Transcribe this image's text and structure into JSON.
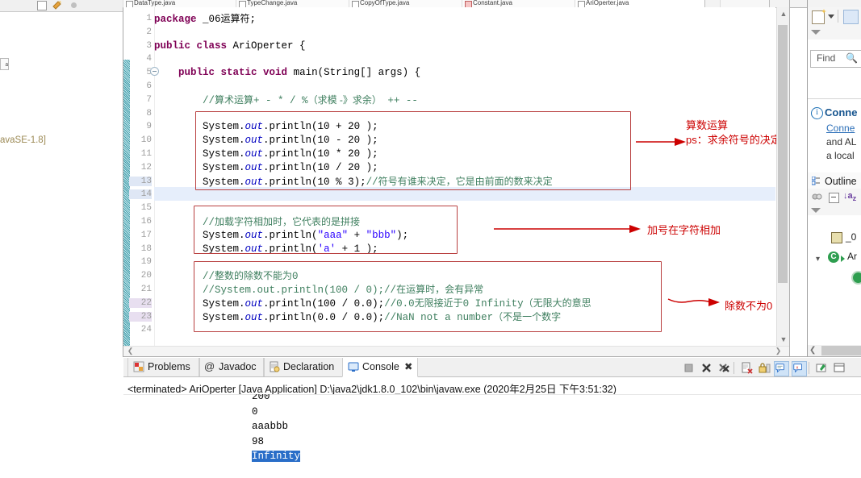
{
  "app": {
    "ide": "Eclipse",
    "perspective": "Java"
  },
  "left_panel": {
    "jre_label": "avaSE-1.8]",
    "node_glyph": "a",
    "toolbar_icons": [
      "new-file-icon",
      "view-menu-icon",
      "collapse-all-icon"
    ]
  },
  "editor": {
    "tabs": [
      {
        "label": "DataType.java",
        "active": false,
        "dirty": false
      },
      {
        "label": "TypeChange.java",
        "active": false,
        "dirty": false
      },
      {
        "label": "CopyOfType.java",
        "active": false,
        "dirty": false
      },
      {
        "label": "Constant.java",
        "active": false,
        "dirty": true
      },
      {
        "label": "AriOperter.java",
        "active": true,
        "dirty": false
      }
    ],
    "line_numbers": [
      1,
      2,
      3,
      4,
      5,
      6,
      7,
      8,
      9,
      10,
      11,
      12,
      13,
      14,
      15,
      16,
      17,
      18,
      19,
      20,
      21,
      22,
      23,
      24
    ],
    "current_line": 14,
    "code_lines": [
      {
        "n": 1,
        "segments": [
          {
            "t": "package ",
            "c": "kw"
          },
          {
            "t": "_06",
            "c": ""
          },
          {
            "t": "运算符",
            "c": "cn"
          },
          {
            "t": ";",
            "c": ""
          }
        ]
      },
      {
        "n": 2,
        "segments": []
      },
      {
        "n": 3,
        "segments": [
          {
            "t": "public ",
            "c": "kw"
          },
          {
            "t": "class ",
            "c": "kw"
          },
          {
            "t": "AriOperter {",
            "c": ""
          }
        ]
      },
      {
        "n": 4,
        "segments": []
      },
      {
        "n": 5,
        "segments": [
          {
            "t": "    ",
            "c": ""
          },
          {
            "t": "public ",
            "c": "kw"
          },
          {
            "t": "static ",
            "c": "kw"
          },
          {
            "t": "void ",
            "c": "kw"
          },
          {
            "t": "main(String[] args) {",
            "c": ""
          }
        ]
      },
      {
        "n": 6,
        "segments": []
      },
      {
        "n": 7,
        "segments": [
          {
            "t": "        ",
            "c": ""
          },
          {
            "t": "//",
            "c": "cmt"
          },
          {
            "t": "算术运算",
            "c": "cmt cn"
          },
          {
            "t": "+ - * / %",
            "c": "cmt"
          },
          {
            "t": "（求模 -》求余）",
            "c": "cmt cn"
          },
          {
            "t": " ++ --",
            "c": "cmt"
          }
        ]
      },
      {
        "n": 8,
        "segments": []
      },
      {
        "n": 9,
        "segments": [
          {
            "t": "        System.",
            "c": ""
          },
          {
            "t": "out",
            "c": "fld"
          },
          {
            "t": ".println(10 + 20 );",
            "c": ""
          }
        ]
      },
      {
        "n": 10,
        "segments": [
          {
            "t": "        System.",
            "c": ""
          },
          {
            "t": "out",
            "c": "fld"
          },
          {
            "t": ".println(10 - 20 );",
            "c": ""
          }
        ]
      },
      {
        "n": 11,
        "segments": [
          {
            "t": "        System.",
            "c": ""
          },
          {
            "t": "out",
            "c": "fld"
          },
          {
            "t": ".println(10 * 20 );",
            "c": ""
          }
        ]
      },
      {
        "n": 12,
        "segments": [
          {
            "t": "        System.",
            "c": ""
          },
          {
            "t": "out",
            "c": "fld"
          },
          {
            "t": ".println(10 / 20 );",
            "c": ""
          }
        ]
      },
      {
        "n": 13,
        "segments": [
          {
            "t": "        System.",
            "c": ""
          },
          {
            "t": "out",
            "c": "fld"
          },
          {
            "t": ".println(10 % 3);",
            "c": ""
          },
          {
            "t": "//",
            "c": "cmt"
          },
          {
            "t": "符号有谁来决定，它是由前面的数来决定",
            "c": "cmt cn"
          }
        ]
      },
      {
        "n": 14,
        "segments": []
      },
      {
        "n": 15,
        "segments": []
      },
      {
        "n": 16,
        "segments": [
          {
            "t": "        ",
            "c": ""
          },
          {
            "t": "//",
            "c": "cmt"
          },
          {
            "t": "加载字符相加时，它代表的是拼接",
            "c": "cmt cn"
          }
        ]
      },
      {
        "n": 17,
        "segments": [
          {
            "t": "        System.",
            "c": ""
          },
          {
            "t": "out",
            "c": "fld"
          },
          {
            "t": ".println(",
            "c": ""
          },
          {
            "t": "\"aaa\"",
            "c": "str"
          },
          {
            "t": " + ",
            "c": ""
          },
          {
            "t": "\"bbb\"",
            "c": "str"
          },
          {
            "t": ");",
            "c": ""
          }
        ]
      },
      {
        "n": 18,
        "segments": [
          {
            "t": "        System.",
            "c": ""
          },
          {
            "t": "out",
            "c": "fld"
          },
          {
            "t": ".println(",
            "c": ""
          },
          {
            "t": "'a'",
            "c": "str"
          },
          {
            "t": " + 1 );",
            "c": ""
          }
        ]
      },
      {
        "n": 19,
        "segments": []
      },
      {
        "n": 20,
        "segments": [
          {
            "t": "        ",
            "c": ""
          },
          {
            "t": "//",
            "c": "cmt"
          },
          {
            "t": "整数的除数不能为",
            "c": "cmt cn"
          },
          {
            "t": "0",
            "c": "cmt"
          }
        ]
      },
      {
        "n": 21,
        "segments": [
          {
            "t": "        ",
            "c": ""
          },
          {
            "t": "//System.out.println(100 / 0);//",
            "c": "cmt"
          },
          {
            "t": "在运算时，会有异常",
            "c": "cmt cn"
          }
        ]
      },
      {
        "n": 22,
        "segments": [
          {
            "t": "        System.",
            "c": ""
          },
          {
            "t": "out",
            "c": "fld"
          },
          {
            "t": ".println(100 / 0.0);",
            "c": ""
          },
          {
            "t": "//0.0",
            "c": "cmt"
          },
          {
            "t": "无限接近于",
            "c": "cmt cn"
          },
          {
            "t": "0 Infinity",
            "c": "cmt"
          },
          {
            "t": "（无限大的意思",
            "c": "cmt cn"
          }
        ]
      },
      {
        "n": 23,
        "segments": [
          {
            "t": "        System.",
            "c": ""
          },
          {
            "t": "out",
            "c": "fld"
          },
          {
            "t": ".println(0.0 / 0.0);",
            "c": ""
          },
          {
            "t": "//NaN not a number",
            "c": "cmt"
          },
          {
            "t": "（不是一个数字",
            "c": "cmt cn"
          }
        ]
      },
      {
        "n": 24,
        "segments": []
      }
    ],
    "markup_boxes": [
      {
        "name": "arithmetic-ops-box",
        "lines": "9-13"
      },
      {
        "name": "string-concat-box",
        "lines": "16-18"
      },
      {
        "name": "division-by-zero-box",
        "lines": "20-23"
      }
    ],
    "annotations": [
      {
        "name": "annotation-arithmetic",
        "line1": "算数运算",
        "line2": "ps：求余符号的决定"
      },
      {
        "name": "annotation-plus-on-strings",
        "line1": "加号在字符相加",
        "line2": ""
      },
      {
        "name": "annotation-divisor-nonzero",
        "line1": "除数不为0",
        "line2": ""
      }
    ]
  },
  "right_panel": {
    "find_label": "Find",
    "find_icon": "magnifier-icon",
    "connection_title": "Conne",
    "connection_line1": "Conne",
    "connection_line2": "and AL",
    "connection_line3": "a local",
    "outline_title": "Outline",
    "outline_items": [
      {
        "label": "_0",
        "icon": "package-icon"
      },
      {
        "label": "Ar",
        "icon": "class-icon"
      },
      {
        "label": "",
        "icon": "method-icon"
      }
    ]
  },
  "bottom_panel": {
    "tabs": [
      {
        "label": "Problems",
        "icon": "problems-icon",
        "active": false,
        "closable": false
      },
      {
        "label": "Javadoc",
        "icon": "javadoc-icon",
        "active": false,
        "closable": false
      },
      {
        "label": "Declaration",
        "icon": "declaration-icon",
        "active": false,
        "closable": false
      },
      {
        "label": "Console",
        "icon": "console-icon",
        "active": true,
        "closable": true
      }
    ],
    "toolbar_icons": [
      "terminate-icon",
      "remove-launch-icon",
      "remove-all-terminated-icon",
      "clear-console-icon",
      "scroll-lock-icon",
      "pin-console-icon",
      "display-selected-console-icon",
      "open-console-icon",
      "minimize-icon"
    ],
    "console_header": "<terminated> AriOperter [Java Application] D:\\java2\\jdk1.8.0_102\\bin\\javaw.exe (2020年2月25日 下午3:51:32)",
    "console_lines": [
      {
        "text": "200",
        "selected": false,
        "clipped_top": true
      },
      {
        "text": "0",
        "selected": false
      },
      {
        "text": "aaabbb",
        "selected": false
      },
      {
        "text": "98",
        "selected": false
      },
      {
        "text": "Infinity",
        "selected": true
      }
    ]
  },
  "colors": {
    "keyword": "#7f0055",
    "comment": "#3f7f5f",
    "string": "#2a00ff",
    "field": "#0000c0",
    "annotation_red": "#cc0000",
    "box_red": "#b94040",
    "selection_blue": "#2a6ec8",
    "current_line": "#e6eefb"
  }
}
